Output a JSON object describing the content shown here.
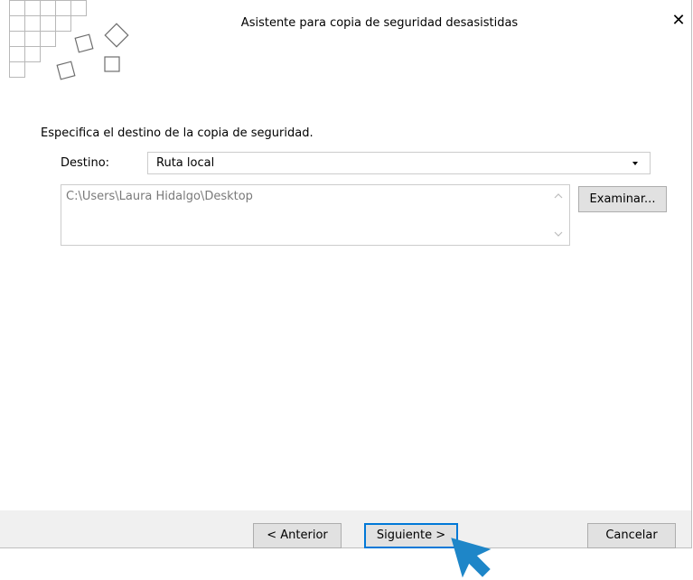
{
  "window": {
    "title": "Asistente para copia de seguridad desasistidas",
    "close_glyph": "✕"
  },
  "main": {
    "instruction": "Especifica el destino de la copia de seguridad.",
    "destination_label": "Destino:",
    "destination_value": "Ruta local",
    "path_value": "C:\\Users\\Laura Hidalgo\\Desktop",
    "browse_label": "Examinar..."
  },
  "footer": {
    "back_label": "< Anterior",
    "next_label": "Siguiente >",
    "cancel_label": "Cancelar"
  },
  "colors": {
    "accent": "#0078d7",
    "cursor": "#1e86c8",
    "footer_bg": "#f0f0f0",
    "disabled_text": "#7a7a7a"
  },
  "icons": [
    "wizard-logo-icon",
    "close-icon",
    "dropdown-arrow-icon",
    "scroll-up-icon",
    "scroll-down-icon",
    "mouse-pointer-icon"
  ]
}
